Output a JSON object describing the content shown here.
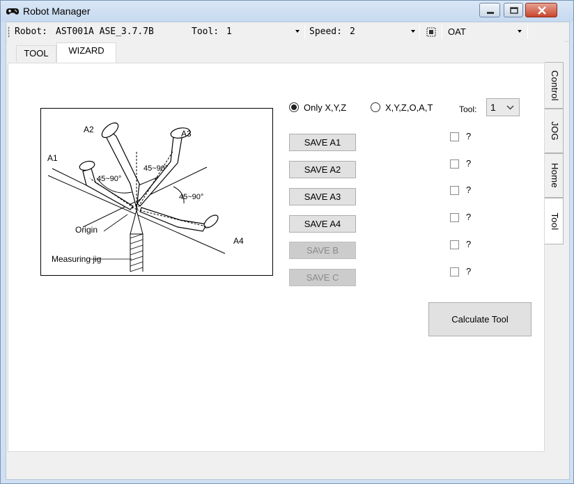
{
  "window": {
    "title": "Robot Manager",
    "icon": "gamepad-icon",
    "controls": [
      "minimize-icon",
      "maximize-icon",
      "close-icon"
    ]
  },
  "toolbar": {
    "robot_label": "Robot:",
    "robot_value": "AST001A ASE_3.7.7B",
    "tool_label": "Tool:",
    "tool_value": "1",
    "speed_label": "Speed:",
    "speed_value": "2",
    "frame_icon": "frame-grid-icon",
    "mode_value": "OAT"
  },
  "tabs": [
    {
      "label": "TOOL"
    },
    {
      "label": "WIZARD"
    }
  ],
  "side_tabs": [
    {
      "label": "Control"
    },
    {
      "label": "JOG"
    },
    {
      "label": "Home"
    },
    {
      "label": "Tool"
    }
  ],
  "diagram": {
    "labels": {
      "a1": "A1",
      "a2": "A2",
      "a3": "A3",
      "a4": "A4",
      "angle1": "45~90°",
      "angle2": "45~90°",
      "angle3": "45~90°",
      "origin": "Origin",
      "jig": "Measuring jig"
    }
  },
  "wizard": {
    "radio_xyz": "Only X,Y,Z",
    "radio_xyzoat": "X,Y,Z,O,A,T",
    "radio_selected": "Only X,Y,Z",
    "tool_label": "Tool:",
    "tool_value": "1",
    "buttons": [
      {
        "label": "SAVE A1",
        "enabled": true
      },
      {
        "label": "SAVE A2",
        "enabled": true
      },
      {
        "label": "SAVE A3",
        "enabled": true
      },
      {
        "label": "SAVE A4",
        "enabled": true
      },
      {
        "label": "SAVE B",
        "enabled": false
      },
      {
        "label": "SAVE C",
        "enabled": false
      }
    ],
    "status_marks": [
      "?",
      "?",
      "?",
      "?",
      "?",
      "?"
    ],
    "calculate_label": "Calculate Tool"
  },
  "colors": {
    "window_frame": "#cfe0f3",
    "close_button": "#c9462c",
    "disabled_text": "#8a8a8a"
  }
}
